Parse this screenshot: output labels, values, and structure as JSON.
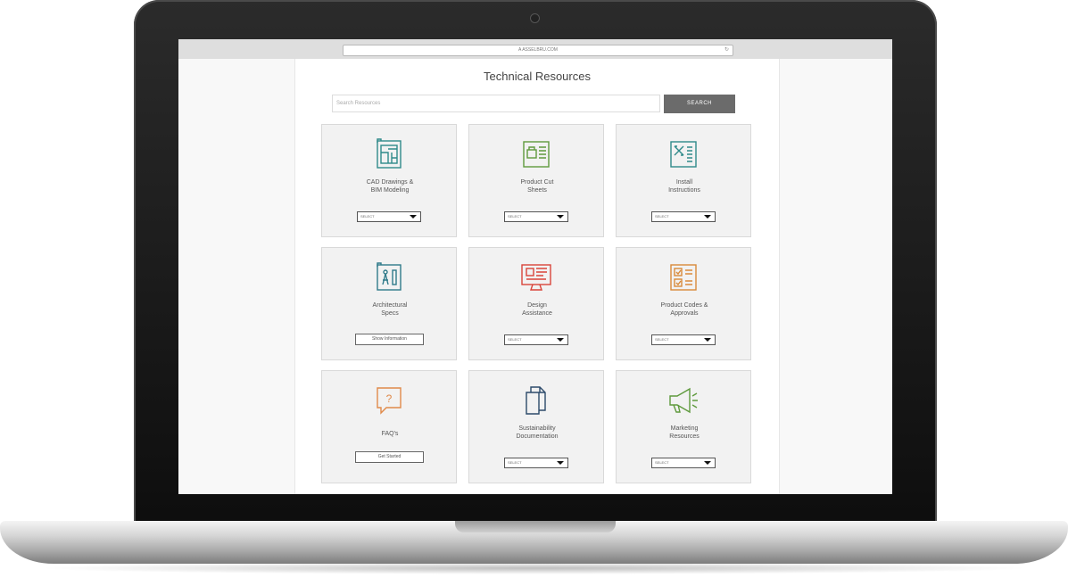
{
  "browser": {
    "url": "A  ASSELBRU.COM"
  },
  "page": {
    "title": "Technical Resources",
    "search_placeholder": "Search Resources",
    "search_button": "SEARCH"
  },
  "cards": [
    {
      "label_line1": "CAD Drawings &",
      "label_line2": "BIM Modeling",
      "control": "SELECT",
      "icon": "blueprint-icon",
      "icon_color": "#2f8a8a"
    },
    {
      "label_line1": "Product Cut",
      "label_line2": "Sheets",
      "control": "SELECT",
      "icon": "product-sheet-icon",
      "icon_color": "#5f9a3d"
    },
    {
      "label_line1": "Install",
      "label_line2": "Instructions",
      "control": "SELECT",
      "icon": "install-tools-icon",
      "icon_color": "#2f8a8a"
    },
    {
      "label_line1": "Architectural",
      "label_line2": "Specs",
      "control": "Show Information",
      "icon": "architectural-specs-icon",
      "icon_color": "#2f7a8a"
    },
    {
      "label_line1": "Design",
      "label_line2": "Assistance",
      "control": "SELECT",
      "icon": "monitor-icon",
      "icon_color": "#d9453a"
    },
    {
      "label_line1": "Product Codes &",
      "label_line2": "Approvals",
      "control": "SELECT",
      "icon": "approvals-checklist-icon",
      "icon_color": "#d98a3a"
    },
    {
      "label_line1": "FAQ's",
      "label_line2": "",
      "control": "Get Started",
      "icon": "question-bubble-icon",
      "icon_color": "#e08a4a"
    },
    {
      "label_line1": "Sustainability",
      "label_line2": "Documentation",
      "control": "SELECT",
      "icon": "documents-icon",
      "icon_color": "#2c4a6a"
    },
    {
      "label_line1": "Marketing",
      "label_line2": "Resources",
      "control": "SELECT",
      "icon": "megaphone-icon",
      "icon_color": "#5f9a3d"
    }
  ]
}
